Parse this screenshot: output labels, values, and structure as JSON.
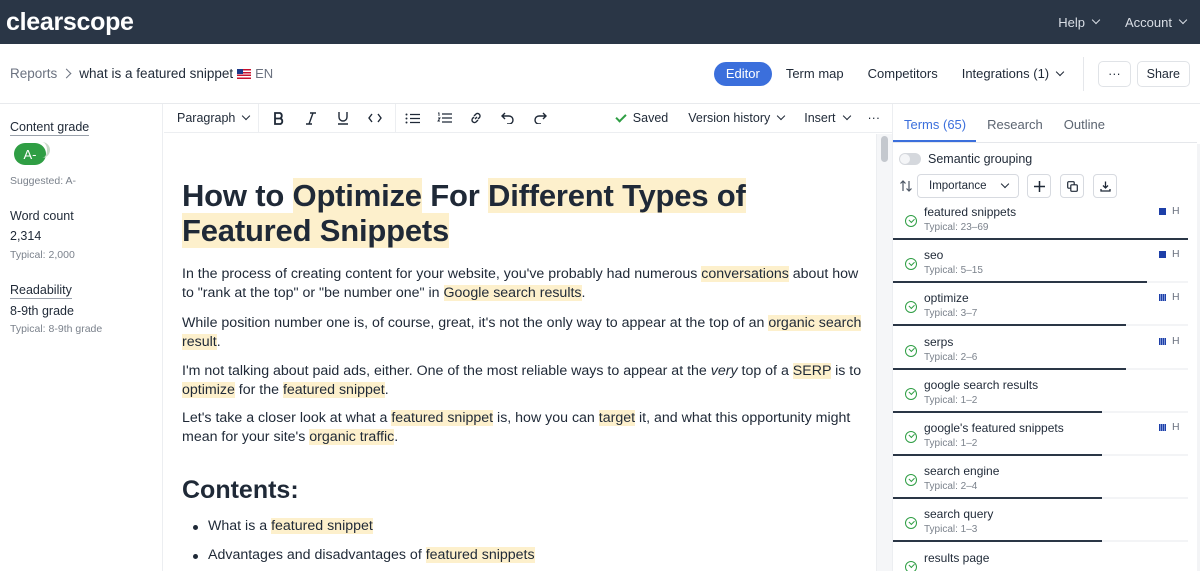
{
  "topnav": {
    "logo": "clearscope",
    "help": "Help",
    "account": "Account"
  },
  "header": {
    "breadcrumb_root": "Reports",
    "breadcrumb_current": "what is a featured snippet",
    "language": "EN",
    "tabs": [
      "Editor",
      "Term map",
      "Competitors",
      "Integrations (1)"
    ],
    "more": "···",
    "share": "Share"
  },
  "sidebar": {
    "content_grade_label": "Content grade",
    "grade": "A-",
    "suggested": "Suggested: A-",
    "word_count_label": "Word count",
    "word_count": "2,314",
    "word_typical": "Typical: 2,000",
    "readability_label": "Readability",
    "readability": "8-9th grade",
    "readability_typical": "Typical: 8-9th grade"
  },
  "toolbar": {
    "paragraph": "Paragraph",
    "saved": "Saved",
    "version_history": "Version history",
    "insert": "Insert",
    "more": "···"
  },
  "document": {
    "title_parts": [
      {
        "t": "How to ",
        "h": false
      },
      {
        "t": "Optimize",
        "h": true
      },
      {
        "t": " For ",
        "h": false
      },
      {
        "t": "Different Types of Featured Snippets",
        "h": true
      }
    ],
    "paragraphs": [
      [
        {
          "t": "In the process of creating content for your website, you've probably had numerous ",
          "h": false
        },
        {
          "t": "conversations",
          "h": true
        },
        {
          "t": " about how to \"rank at the top\" or \"be number one\" in ",
          "h": false
        },
        {
          "t": "Google search results",
          "h": true
        },
        {
          "t": ".",
          "h": false
        }
      ],
      [
        {
          "t": "While position number one is, of course, great, it's not the only way to appear at the top of an ",
          "h": false
        },
        {
          "t": "organic search result",
          "h": true
        },
        {
          "t": ".",
          "h": false
        }
      ],
      [
        {
          "t": "I'm not talking about paid ads, either. One of the most reliable ways to appear at the ",
          "h": false
        },
        {
          "t": "very",
          "h": false,
          "i": true
        },
        {
          "t": " top of a ",
          "h": false
        },
        {
          "t": "SERP",
          "h": true
        },
        {
          "t": " is to ",
          "h": false
        },
        {
          "t": "optimize",
          "h": true
        },
        {
          "t": " for the ",
          "h": false
        },
        {
          "t": "featured snippet",
          "h": true
        },
        {
          "t": ".",
          "h": false
        }
      ],
      [
        {
          "t": "Let's take a closer look at what a ",
          "h": false
        },
        {
          "t": "featured snippet",
          "h": true
        },
        {
          "t": " is, how you can ",
          "h": false
        },
        {
          "t": "target",
          "h": true
        },
        {
          "t": " it, and what this opportunity might mean for your site's ",
          "h": false
        },
        {
          "t": "organic traffic",
          "h": true
        },
        {
          "t": ".",
          "h": false
        }
      ]
    ],
    "contents_heading": "Contents:",
    "list_items": [
      [
        {
          "t": "What is a ",
          "h": false
        },
        {
          "t": "featured snippet",
          "h": true
        }
      ],
      [
        {
          "t": "Advantages and disadvantages of ",
          "h": false
        },
        {
          "t": "featured snippets",
          "h": true
        }
      ]
    ]
  },
  "panel": {
    "tabs": [
      "Terms (65)",
      "Research",
      "Outline"
    ],
    "semantic_grouping": "Semantic grouping",
    "sort_select": "Importance",
    "terms": [
      {
        "name": "featured snippets",
        "typical": "Typical: 23–69",
        "progress": 1.0,
        "heading": "full",
        "h": "H"
      },
      {
        "name": "seo",
        "typical": "Typical: 5–15",
        "progress": 0.86,
        "heading": "full",
        "h": "H"
      },
      {
        "name": "optimize",
        "typical": "Typical: 3–7",
        "progress": 0.79,
        "heading": "part",
        "h": "H"
      },
      {
        "name": "serps",
        "typical": "Typical: 2–6",
        "progress": 0.79,
        "heading": "part",
        "h": "H"
      },
      {
        "name": "google search results",
        "typical": "Typical: 1–2",
        "progress": 0.71,
        "heading": "none",
        "h": ""
      },
      {
        "name": "google's featured snippets",
        "typical": "Typical: 1–2",
        "progress": 0.71,
        "heading": "part",
        "h": "H"
      },
      {
        "name": "search engine",
        "typical": "Typical: 2–4",
        "progress": 0.71,
        "heading": "none",
        "h": ""
      },
      {
        "name": "search query",
        "typical": "Typical: 1–3",
        "progress": 0.71,
        "heading": "none",
        "h": ""
      },
      {
        "name": "results page",
        "typical": "",
        "progress": 0.0,
        "heading": "none",
        "h": ""
      }
    ]
  },
  "colors": {
    "nav_bg": "#2a3646",
    "accent": "#3b6fdc",
    "grade_green": "#2f9e44",
    "highlight": "#fdf0cc"
  }
}
